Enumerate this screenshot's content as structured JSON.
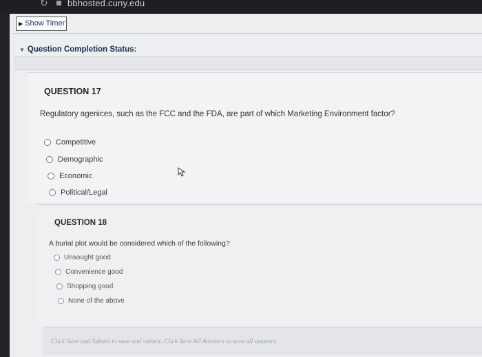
{
  "browser": {
    "url": "bbhosted.cuny.edu"
  },
  "toolbar": {
    "show_timer_label": "Show Timer"
  },
  "status": {
    "label": "Question Completion Status:"
  },
  "question17": {
    "title": "QUESTION 17",
    "text": "Regulatory agenices, such as the FCC and the FDA, are part of which Marketing Environment factor?",
    "options": [
      "Competitive",
      "Demographic",
      "Economic",
      "Political/Legal"
    ]
  },
  "question18": {
    "title": "QUESTION 18",
    "text": "A burial plot would be considered which of the following?",
    "options": [
      "Unsought good",
      "Convenience good",
      "Shopping good",
      "None of the above"
    ]
  },
  "footer": {
    "instructions": "Click Save and Submit to save and submit. Click Save All Answers to save all answers."
  }
}
